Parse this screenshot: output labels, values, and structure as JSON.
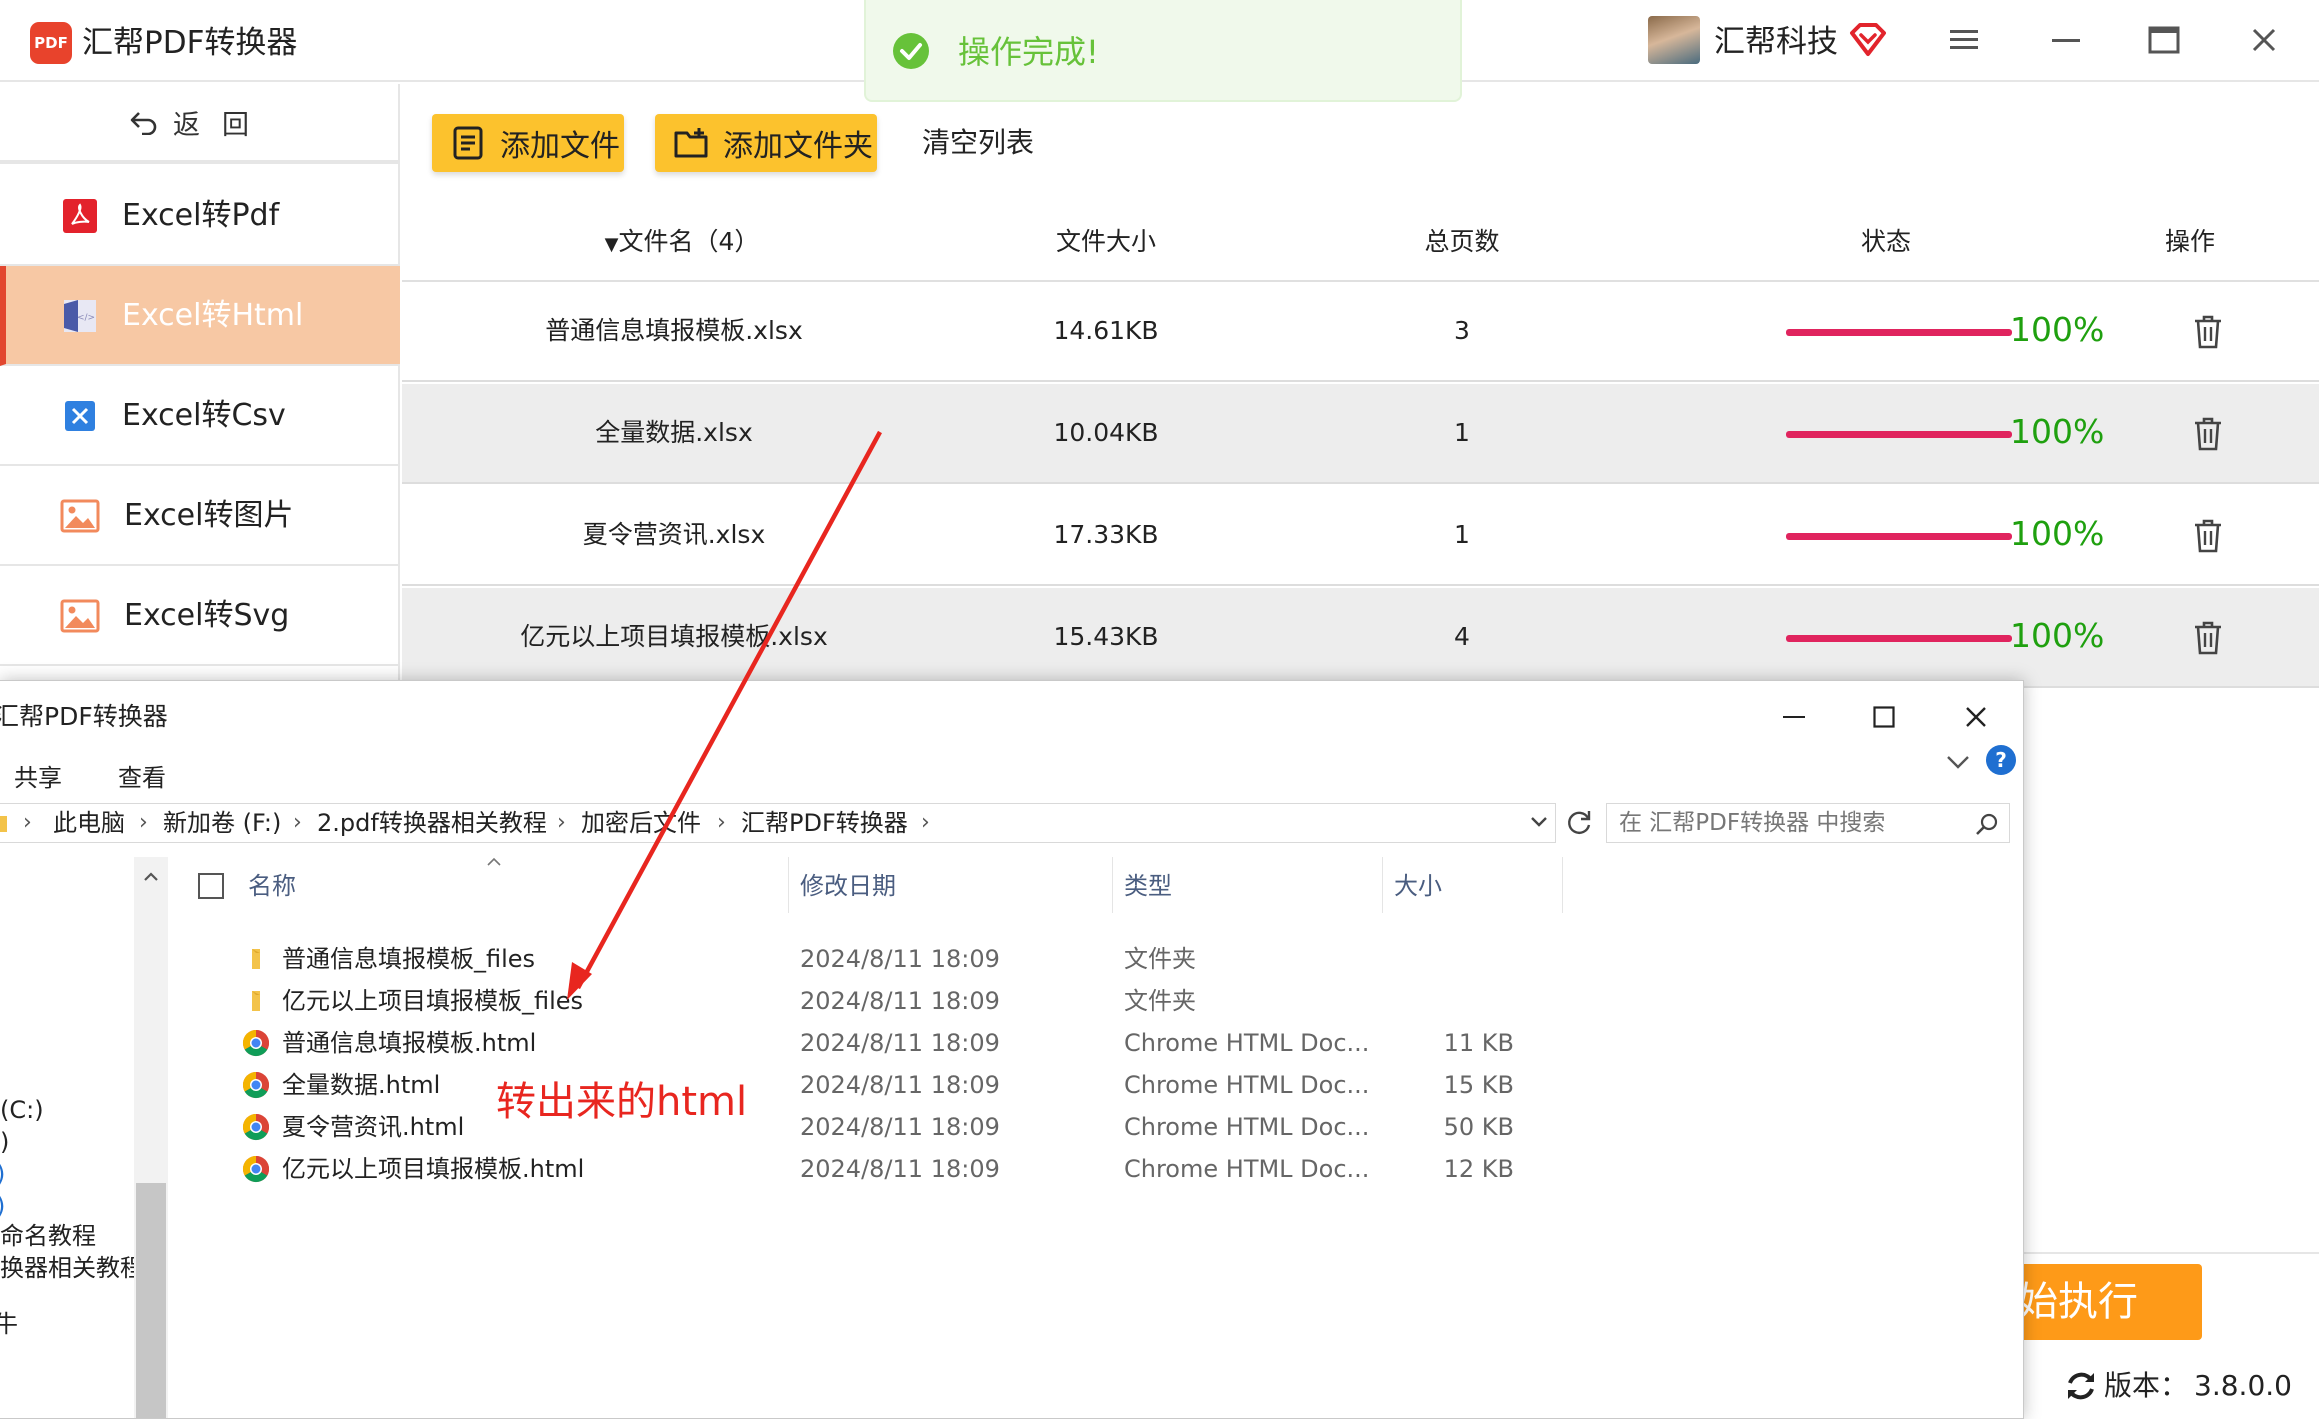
{
  "app": {
    "logo_text": "PDF",
    "title": "汇帮PDF转换器",
    "company": "汇帮科技",
    "version_label": "版本：",
    "version": "3.8.0.0",
    "start_button": "开始执行",
    "accent": "#e2472f",
    "button_yellow": "#fcc22d",
    "start_orange": "#fe9a18"
  },
  "toast": {
    "text": "操作完成!",
    "color": "#67c23a"
  },
  "sidebar": {
    "back_label": "返回",
    "items": [
      {
        "label": "Excel转Pdf",
        "icon": "pdf-icon",
        "active": false
      },
      {
        "label": "Excel转Html",
        "icon": "html-doc-icon",
        "active": true
      },
      {
        "label": "Excel转Csv",
        "icon": "csv-icon",
        "active": false
      },
      {
        "label": "Excel转图片",
        "icon": "image-icon",
        "active": false
      },
      {
        "label": "Excel转Svg",
        "icon": "image-icon",
        "active": false
      }
    ]
  },
  "toolbar": {
    "add_file": "添加文件",
    "add_folder": "添加文件夹",
    "clear_list": "清空列表"
  },
  "table": {
    "headers": {
      "name": "文件名（4）",
      "size": "文件大小",
      "pages": "总页数",
      "status": "状态",
      "action": "操作"
    },
    "rows": [
      {
        "name": "普通信息填报模板.xlsx",
        "size": "14.61KB",
        "pages": "3",
        "progress": 100,
        "percent": "100%"
      },
      {
        "name": "全量数据.xlsx",
        "size": "10.04KB",
        "pages": "1",
        "progress": 100,
        "percent": "100%"
      },
      {
        "name": "夏令营资讯.xlsx",
        "size": "17.33KB",
        "pages": "1",
        "progress": 100,
        "percent": "100%"
      },
      {
        "name": "亿元以上项目填报模板.xlsx",
        "size": "15.43KB",
        "pages": "4",
        "progress": 100,
        "percent": "100%"
      }
    ],
    "progress_color": "#e0245e",
    "percent_color": "#1fa00f"
  },
  "explorer": {
    "title": "汇帮PDF转换器",
    "ribbon": [
      "共享",
      "查看"
    ],
    "breadcrumb": [
      "此电脑",
      "新加卷 (F:)",
      "2.pdf转换器相关教程",
      "加密后文件",
      "汇帮PDF转换器"
    ],
    "search_placeholder": "在 汇帮PDF转换器 中搜索",
    "nav_items": [
      "(C:)",
      ")",
      "命名教程",
      "换器相关教程",
      "牛"
    ],
    "columns": {
      "name": "名称",
      "date": "修改日期",
      "type": "类型",
      "size": "大小"
    },
    "files": [
      {
        "name": "普通信息填报模板_files",
        "date": "2024/8/11 18:09",
        "type": "文件夹",
        "size": "",
        "icon": "folder-icon"
      },
      {
        "name": "亿元以上项目填报模板_files",
        "date": "2024/8/11 18:09",
        "type": "文件夹",
        "size": "",
        "icon": "folder-icon"
      },
      {
        "name": "普通信息填报模板.html",
        "date": "2024/8/11 18:09",
        "type": "Chrome HTML Doc...",
        "size": "11 KB",
        "icon": "chrome-icon"
      },
      {
        "name": "全量数据.html",
        "date": "2024/8/11 18:09",
        "type": "Chrome HTML Doc...",
        "size": "15 KB",
        "icon": "chrome-icon"
      },
      {
        "name": "夏令营资讯.html",
        "date": "2024/8/11 18:09",
        "type": "Chrome HTML Doc...",
        "size": "50 KB",
        "icon": "chrome-icon"
      },
      {
        "name": "亿元以上项目填报模板.html",
        "date": "2024/8/11 18:09",
        "type": "Chrome HTML Doc...",
        "size": "12 KB",
        "icon": "chrome-icon"
      }
    ],
    "annotation": "转出来的html",
    "annotation_color": "#e8261f"
  }
}
